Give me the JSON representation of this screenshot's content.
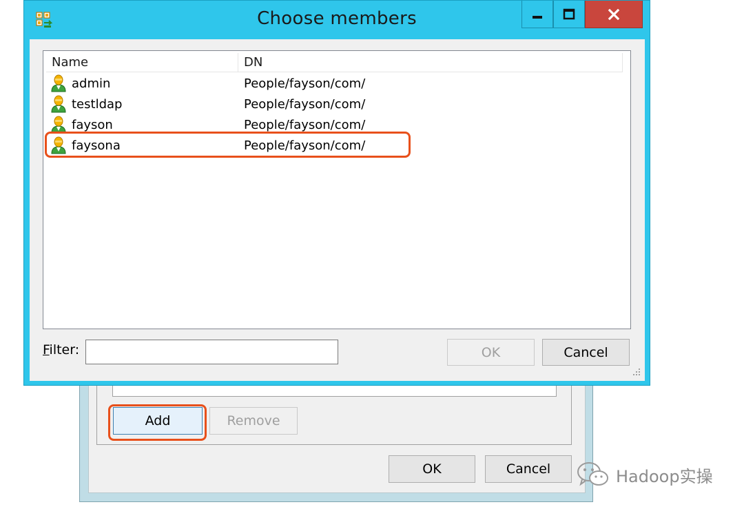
{
  "dialog": {
    "title": "Choose members",
    "list": {
      "columns": [
        "Name",
        "DN"
      ],
      "rows": [
        {
          "name": "admin",
          "dn": "People/fayson/com/"
        },
        {
          "name": "testldap",
          "dn": "People/fayson/com/"
        },
        {
          "name": "fayson",
          "dn": "People/fayson/com/"
        },
        {
          "name": "faysona",
          "dn": "People/fayson/com/"
        }
      ]
    },
    "filter_label_accel": "F",
    "filter_label_rest": "ilter:",
    "filter_value": "",
    "ok_label": "OK",
    "cancel_label": "Cancel"
  },
  "background_dialog": {
    "add_label": "Add",
    "remove_label": "Remove",
    "ok_label": "OK",
    "cancel_label": "Cancel"
  },
  "watermark": {
    "text": "Hadoop实操"
  },
  "colors": {
    "title_bar": "#2fc6eb",
    "close_button": "#c9463d",
    "highlight": "#e8501b"
  },
  "icons": {
    "app": "app-icon",
    "user": "user-icon",
    "minimize": "minimize-icon",
    "maximize": "maximize-icon",
    "close": "close-icon",
    "watermark": "wechat-icon"
  }
}
